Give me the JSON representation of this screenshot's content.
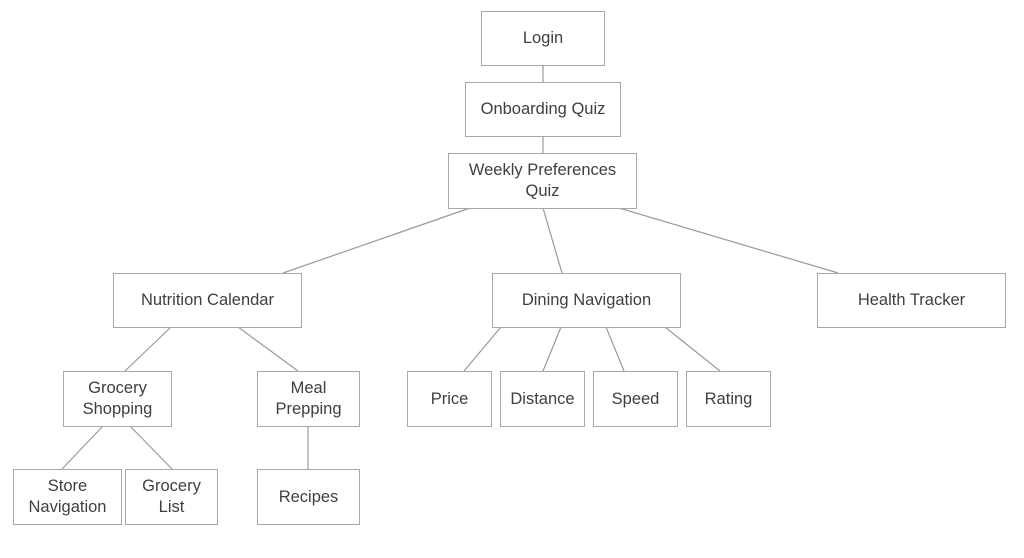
{
  "diagram": {
    "type": "sitemap",
    "nodes": {
      "login": "Login",
      "onboarding": "Onboarding Quiz",
      "weekly": "Weekly Preferences\nQuiz",
      "nutrition": "Nutrition Calendar",
      "dining": "Dining Navigation",
      "health": "Health Tracker",
      "grocery_shopping": "Grocery\nShopping",
      "meal_prepping": "Meal\nPrepping",
      "store_navigation": "Store\nNavigation",
      "grocery_list": "Grocery\nList",
      "recipes": "Recipes",
      "price": "Price",
      "distance": "Distance",
      "speed": "Speed",
      "rating": "Rating"
    },
    "edges": [
      [
        "login",
        "onboarding"
      ],
      [
        "onboarding",
        "weekly"
      ],
      [
        "weekly",
        "nutrition"
      ],
      [
        "weekly",
        "dining"
      ],
      [
        "weekly",
        "health"
      ],
      [
        "nutrition",
        "grocery_shopping"
      ],
      [
        "nutrition",
        "meal_prepping"
      ],
      [
        "grocery_shopping",
        "store_navigation"
      ],
      [
        "grocery_shopping",
        "grocery_list"
      ],
      [
        "meal_prepping",
        "recipes"
      ],
      [
        "dining",
        "price"
      ],
      [
        "dining",
        "distance"
      ],
      [
        "dining",
        "speed"
      ],
      [
        "dining",
        "rating"
      ]
    ]
  }
}
